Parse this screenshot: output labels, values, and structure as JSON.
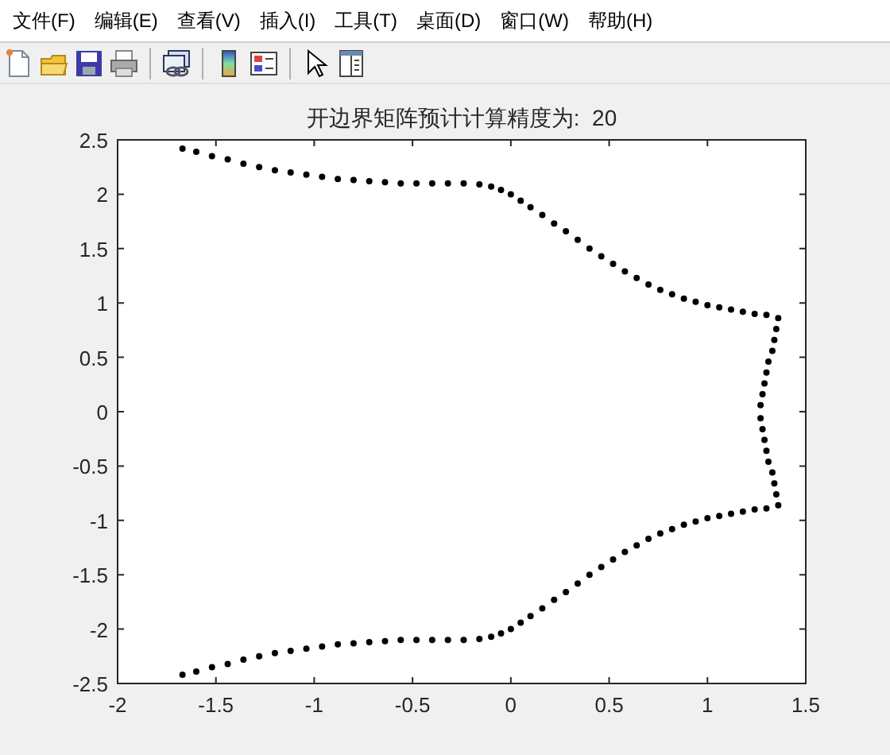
{
  "window": {
    "menu": [
      "文件(F)",
      "编辑(E)",
      "查看(V)",
      "插入(I)",
      "工具(T)",
      "桌面(D)",
      "窗口(W)",
      "帮助(H)"
    ]
  },
  "figure": {
    "chart_data": {
      "type": "scatter",
      "title": "开边界矩阵预计计算精度为:  20",
      "xlim": [
        -2,
        1.5
      ],
      "ylim": [
        -2.5,
        2.5
      ],
      "xticks": [
        {
          "value": -2,
          "label": "-2"
        },
        {
          "value": -1.5,
          "label": "-1.5"
        },
        {
          "value": -1,
          "label": "-1"
        },
        {
          "value": -0.5,
          "label": "-0.5"
        },
        {
          "value": 0,
          "label": "0"
        },
        {
          "value": 0.5,
          "label": "0.5"
        },
        {
          "value": 1,
          "label": "1"
        },
        {
          "value": 1.5,
          "label": "1.5"
        }
      ],
      "yticks": [
        {
          "value": -2.5,
          "label": "-2.5"
        },
        {
          "value": -2,
          "label": "-2"
        },
        {
          "value": -1.5,
          "label": "-1.5"
        },
        {
          "value": -1,
          "label": "-1"
        },
        {
          "value": -0.5,
          "label": "-0.5"
        },
        {
          "value": 0,
          "label": "0"
        },
        {
          "value": 0.5,
          "label": "0.5"
        },
        {
          "value": 1,
          "label": "1"
        },
        {
          "value": 1.5,
          "label": "1.5"
        },
        {
          "value": 2,
          "label": "2"
        },
        {
          "value": 2.5,
          "label": "2.5"
        }
      ],
      "x": [
        -1.67,
        -1.6,
        -1.52,
        -1.44,
        -1.36,
        -1.28,
        -1.2,
        -1.12,
        -1.04,
        -0.96,
        -0.88,
        -0.8,
        -0.72,
        -0.64,
        -0.56,
        -0.48,
        -0.4,
        -0.32,
        -0.24,
        -0.16,
        -0.1,
        -0.05,
        0.0,
        0.05,
        0.1,
        0.16,
        0.22,
        0.28,
        0.34,
        0.4,
        0.46,
        0.52,
        0.58,
        0.64,
        0.7,
        0.76,
        0.82,
        0.88,
        0.94,
        1.0,
        1.06,
        1.12,
        1.18,
        1.24,
        1.3,
        1.36,
        1.35,
        1.34,
        1.33,
        1.31,
        1.3,
        1.29,
        1.28,
        1.27,
        1.27,
        1.28,
        1.29,
        1.3,
        1.31,
        1.33,
        1.34,
        1.35,
        1.36,
        1.3,
        1.24,
        1.18,
        1.12,
        1.06,
        1.0,
        0.94,
        0.88,
        0.82,
        0.76,
        0.7,
        0.64,
        0.58,
        0.52,
        0.46,
        0.4,
        0.34,
        0.28,
        0.22,
        0.16,
        0.1,
        0.05,
        0.0,
        -0.05,
        -0.1,
        -0.16,
        -0.24,
        -0.32,
        -0.4,
        -0.48,
        -0.56,
        -0.64,
        -0.72,
        -0.8,
        -0.88,
        -0.96,
        -1.04,
        -1.12,
        -1.2,
        -1.28,
        -1.36,
        -1.44,
        -1.52,
        -1.6,
        -1.67
      ],
      "series": [
        {
          "color": "#000000",
          "values": [
            2.42,
            2.39,
            2.35,
            2.32,
            2.28,
            2.25,
            2.22,
            2.2,
            2.18,
            2.16,
            2.14,
            2.13,
            2.12,
            2.11,
            2.1,
            2.1,
            2.1,
            2.1,
            2.1,
            2.09,
            2.07,
            2.04,
            2.0,
            1.94,
            1.88,
            1.81,
            1.73,
            1.66,
            1.58,
            1.5,
            1.43,
            1.36,
            1.29,
            1.23,
            1.17,
            1.12,
            1.08,
            1.04,
            1.01,
            0.98,
            0.96,
            0.94,
            0.92,
            0.9,
            0.89,
            0.86,
            0.76,
            0.66,
            0.56,
            0.46,
            0.36,
            0.26,
            0.16,
            0.06,
            -0.06,
            -0.16,
            -0.26,
            -0.36,
            -0.46,
            -0.56,
            -0.66,
            -0.76,
            -0.86,
            -0.89,
            -0.9,
            -0.92,
            -0.94,
            -0.96,
            -0.98,
            -1.01,
            -1.04,
            -1.08,
            -1.12,
            -1.17,
            -1.23,
            -1.29,
            -1.36,
            -1.43,
            -1.5,
            -1.58,
            -1.66,
            -1.73,
            -1.81,
            -1.88,
            -1.94,
            -2.0,
            -2.04,
            -2.07,
            -2.09,
            -2.1,
            -2.1,
            -2.1,
            -2.1,
            -2.1,
            -2.11,
            -2.12,
            -2.13,
            -2.14,
            -2.16,
            -2.18,
            -2.2,
            -2.22,
            -2.25,
            -2.28,
            -2.32,
            -2.35,
            -2.39,
            -2.42
          ]
        }
      ]
    }
  }
}
